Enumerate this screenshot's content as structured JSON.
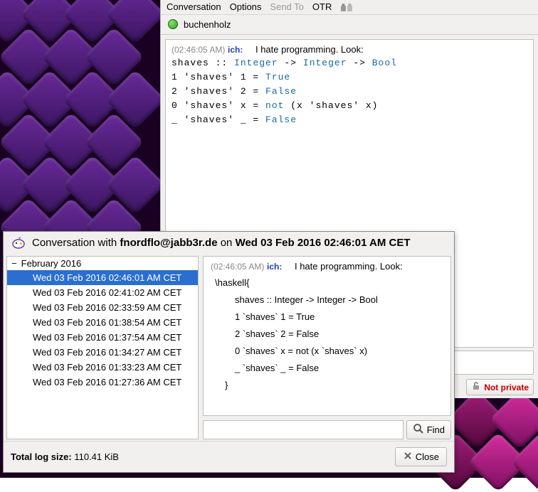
{
  "chat": {
    "menu": {
      "conversation": "Conversation",
      "options": "Options",
      "send_to": "Send To",
      "otr": "OTR"
    },
    "tab": {
      "buddy": "buchenholz"
    },
    "message": {
      "timestamp": "(02:46:05 AM)",
      "sender": "ich:",
      "intro": "I hate programming. Look:"
    },
    "status": {
      "not_private": "Not private"
    }
  },
  "haskell": {
    "sig": {
      "name": "shaves",
      "dcolon": "::",
      "t1": "Integer",
      "arr1": "->",
      "t2": "Integer",
      "arr2": "->",
      "t3": "Bool"
    },
    "l1": {
      "a": "1 'shaves' 1 =",
      "b": "True"
    },
    "l2": {
      "a": "2 'shaves' 2 =",
      "b": "False"
    },
    "l3": {
      "a": "0 'shaves' x =",
      "kw": "not",
      "c": "(x 'shaves' x)"
    },
    "l4": {
      "a": "_ 'shaves' _ =",
      "b": "False"
    }
  },
  "log": {
    "title_prefix": "Conversation with ",
    "jid": "fnordflo@jabb3r.de",
    "title_mid": " on ",
    "title_date": "Wed 03 Feb 2016 02:46:01 AM CET",
    "month": "February 2016",
    "dates": [
      "Wed 03 Feb 2016 02:46:01 AM CET",
      "Wed 03 Feb 2016 02:41:02 AM CET",
      "Wed 03 Feb 2016 02:33:59 AM CET",
      "Wed 03 Feb 2016 01:38:54 AM CET",
      "Wed 03 Feb 2016 01:37:54 AM CET",
      "Wed 03 Feb 2016 01:34:27 AM CET",
      "Wed 03 Feb 2016 01:33:23 AM CET",
      "Wed 03 Feb 2016 01:27:36 AM CET"
    ],
    "msg": {
      "timestamp": "(02:46:05 AM)",
      "sender": "ich:",
      "intro": "I hate programming. Look:",
      "fence": "\\haskell{",
      "l1": "shaves :: Integer -> Integer -> Bool",
      "l2": "1 `shaves` 1 = True",
      "l3": "2 `shaves` 2 = False",
      "l4": "0 `shaves` x = not (x `shaves` x)",
      "l5": "_ `shaves` _ = False",
      "close": "}"
    },
    "find_label": "Find",
    "size_label": "Total log size:",
    "size_value": "110.41 KiB",
    "close_label": "Close"
  },
  "chart_data": null
}
